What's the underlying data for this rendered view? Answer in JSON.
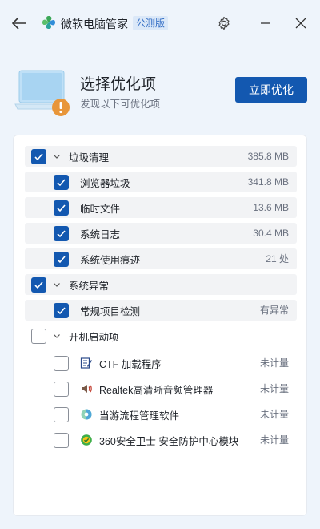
{
  "app": {
    "title": "微软电脑管家",
    "badge": "公测版"
  },
  "header": {
    "title": "选择优化项",
    "subtitle": "发现以下可优化项",
    "action_label": "立即优化"
  },
  "groups": [
    {
      "label": "垃圾清理",
      "value": "385.8 MB",
      "checked": true,
      "items": [
        {
          "label": "浏览器垃圾",
          "value": "341.8 MB",
          "checked": true
        },
        {
          "label": "临时文件",
          "value": "13.6 MB",
          "checked": true
        },
        {
          "label": "系统日志",
          "value": "30.4 MB",
          "checked": true
        },
        {
          "label": "系统使用痕迹",
          "value": "21 处",
          "checked": true
        }
      ]
    },
    {
      "label": "系统异常",
      "value": "",
      "checked": true,
      "items": [
        {
          "label": "常规项目检测",
          "value": "有异常",
          "checked": true
        }
      ]
    },
    {
      "label": "开机启动项",
      "value": "",
      "checked": false,
      "items": [
        {
          "label": "CTF 加载程序",
          "value": "未计量",
          "checked": false,
          "icon": "ctf-loader-icon"
        },
        {
          "label": "Realtek高清晰音频管理器",
          "value": "未计量",
          "checked": false,
          "icon": "speaker-icon"
        },
        {
          "label": "当游流程管理软件",
          "value": "未计量",
          "checked": false,
          "icon": "app-circle-icon"
        },
        {
          "label": "360安全卫士 安全防护中心模块",
          "value": "未计量",
          "checked": false,
          "icon": "360-security-icon"
        }
      ]
    }
  ],
  "colors": {
    "accent": "#1358b0",
    "background": "#eef4fb",
    "row_shade": "#f2f3f5"
  }
}
